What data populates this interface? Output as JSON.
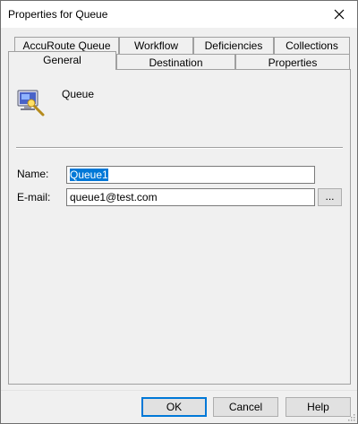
{
  "window": {
    "title": "Properties for Queue"
  },
  "tabs_back": [
    "AccuRoute Queue",
    "Workflow",
    "Deficiencies",
    "Collections"
  ],
  "tabs_front": [
    "General",
    "Destination",
    "Properties"
  ],
  "active_tab": "General",
  "header": {
    "type_label": "Queue"
  },
  "form": {
    "name_label": "Name:",
    "name_value": "Queue1",
    "email_label": "E-mail:",
    "email_value": "queue1@test.com",
    "browse_label": "..."
  },
  "buttons": {
    "ok": "OK",
    "cancel": "Cancel",
    "help": "Help"
  },
  "icons": {
    "queue": "queue-monitor-icon",
    "close": "close-icon",
    "grip": "resize-grip-icon"
  }
}
